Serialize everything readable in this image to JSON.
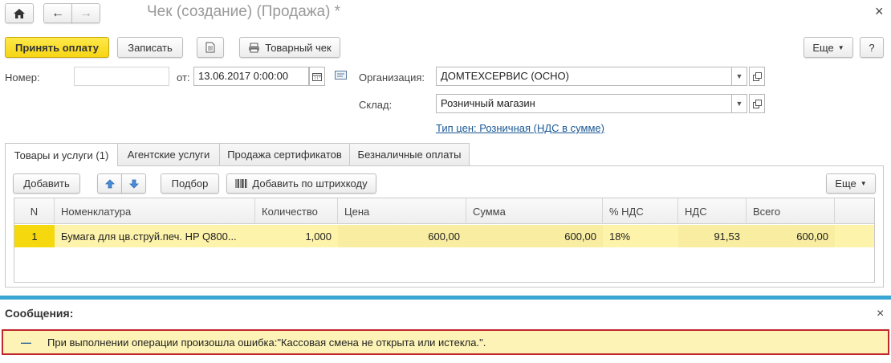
{
  "window": {
    "title": "Чек (создание) (Продажа) *"
  },
  "toolbar": {
    "accept_payment_label": "Принять оплату",
    "save_label": "Записать",
    "receipt_label": "Товарный чек",
    "more_label": "Еще",
    "help_label": "?"
  },
  "form": {
    "number_label": "Номер:",
    "number_value": "",
    "date_label": "от:",
    "date_value": "13.06.2017  0:00:00",
    "org_label": "Организация:",
    "org_value": "ДОМТЕХСЕРВИС (ОСНО)",
    "warehouse_label": "Склад:",
    "warehouse_value": "Розничный магазин",
    "price_type_link": "Тип цен: Розничная (НДС в сумме)"
  },
  "tabs": [
    {
      "label": "Товары и услуги (1)"
    },
    {
      "label": "Агентские услуги"
    },
    {
      "label": "Продажа сертификатов"
    },
    {
      "label": "Безналичные оплаты"
    }
  ],
  "table_toolbar": {
    "add_label": "Добавить",
    "select_label": "Подбор",
    "barcode_label": "Добавить по штрихкоду",
    "more_label": "Еще"
  },
  "table": {
    "columns": [
      "N",
      "Номенклатура",
      "Количество",
      "Цена",
      "Сумма",
      "% НДС",
      "НДС",
      "Всего"
    ],
    "rows": [
      {
        "n": "1",
        "item": "Бумага для цв.струй.печ. HP Q800...",
        "qty": "1,000",
        "price": "600,00",
        "sum": "600,00",
        "vat_rate": "18%",
        "vat": "91,53",
        "total": "600,00"
      }
    ]
  },
  "messages": {
    "title": "Сообщения:",
    "close": "×",
    "dash": "—",
    "text": "При выполнении операции произошла ошибка:\"Кассовая смена не открыта или истекла.\"."
  }
}
